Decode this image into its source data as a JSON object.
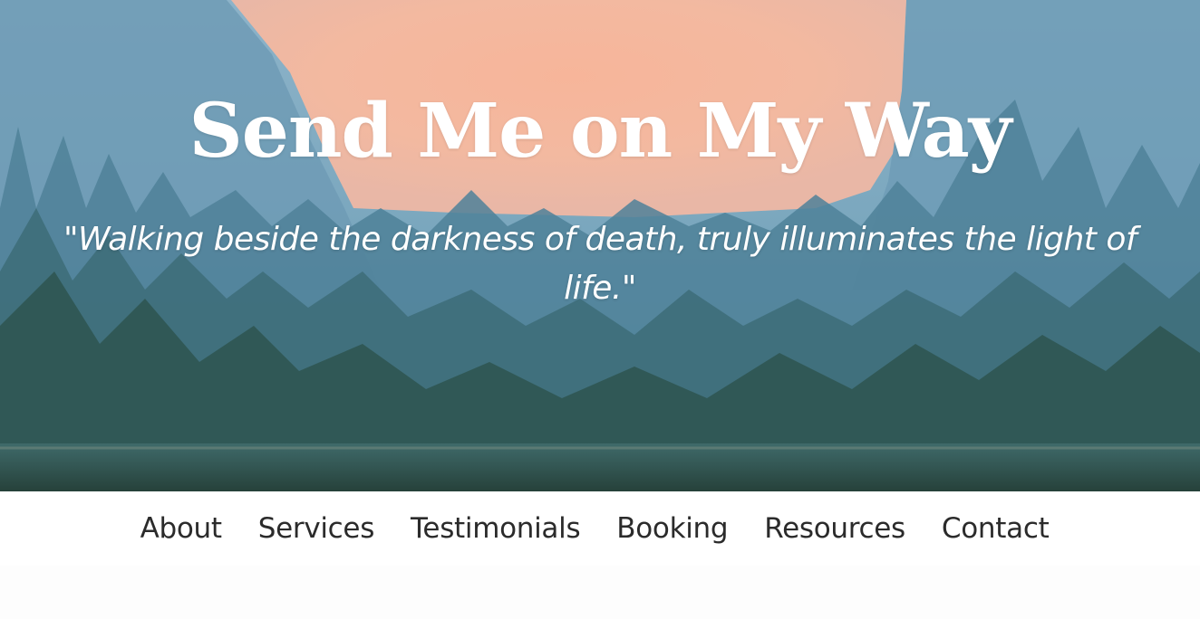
{
  "hero": {
    "title": "Send Me on My Way",
    "quote": "\"Walking beside the darkness of death, truly illuminates the light of life.\""
  },
  "nav": {
    "items": [
      {
        "label": "About"
      },
      {
        "label": "Services"
      },
      {
        "label": "Testimonials"
      },
      {
        "label": "Booking"
      },
      {
        "label": "Resources"
      },
      {
        "label": "Contact"
      }
    ]
  },
  "colors": {
    "sky": "#7aa5c0",
    "sun_glow": "#f4b39a",
    "forest_dark": "#2f4d45",
    "nav_text": "#2b2b2b",
    "nav_background": "#ffffff"
  }
}
